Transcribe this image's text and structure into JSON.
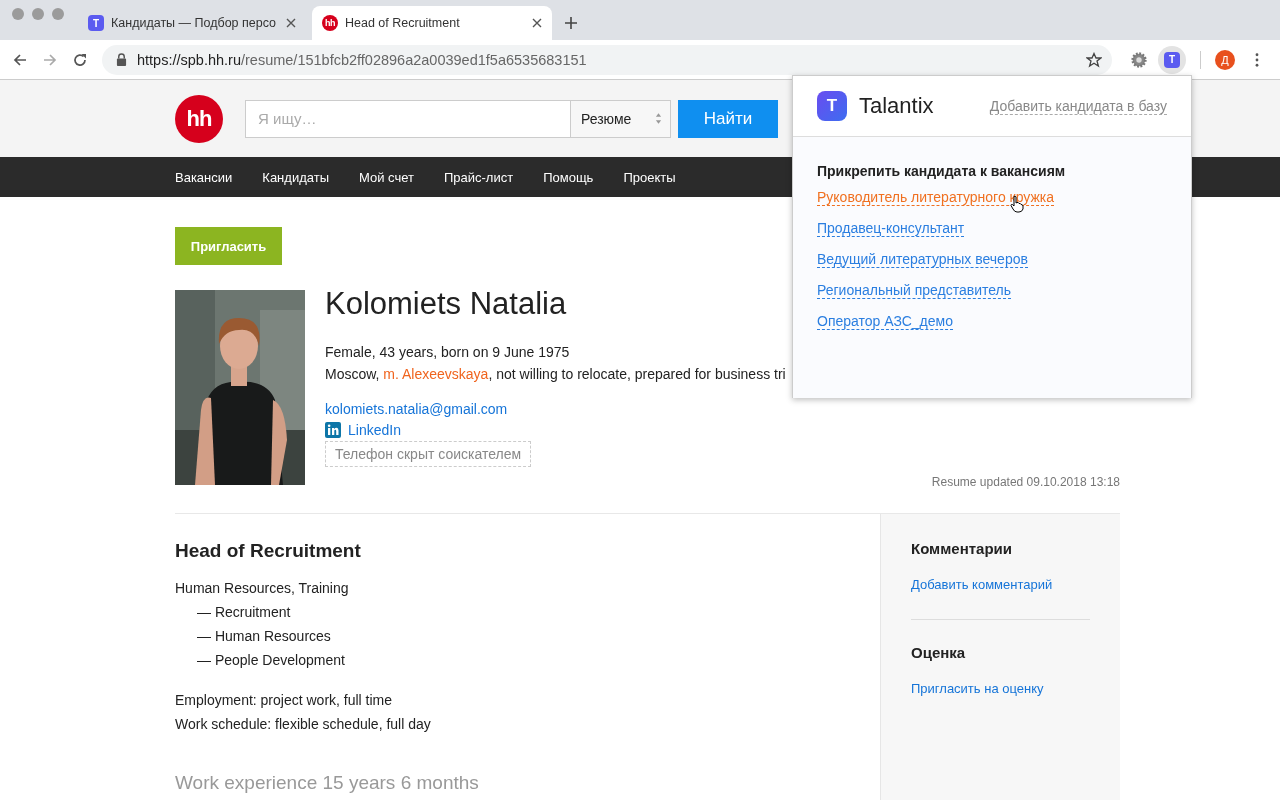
{
  "browser": {
    "tabs": [
      {
        "title": "Кандидаты — Подбор персо",
        "icon_label": "T",
        "kind": "talantix",
        "selected": false
      },
      {
        "title": "Head of Recruitment",
        "icon_label": "hh",
        "kind": "hh",
        "selected": true
      }
    ],
    "url": {
      "host": "https://spb.hh.ru",
      "path": "/resume/151bfcb2ff02896a2a0039ed1f5a6535683151"
    },
    "extension_label": "T",
    "avatar": "Д"
  },
  "header": {
    "logo": "hh",
    "search": {
      "placeholder": "Я ищу…"
    },
    "type_select": "Резюме",
    "search_button": "Найти"
  },
  "nav": [
    "Вакансии",
    "Кандидаты",
    "Мой счет",
    "Прайс-лист",
    "Помощь",
    "Проекты"
  ],
  "invite_button": "Пригласить",
  "profile": {
    "name": "Kolomiets Natalia",
    "details": "Female, 43 years, born on 9 June 1975",
    "city": "Moscow, ",
    "metro": "m. Alexeevskaya",
    "relocation": ", not willing to relocate, prepared for business tri",
    "email": "kolomiets.natalia@gmail.com",
    "linkedin": "LinkedIn",
    "phone": "Телефон скрыт соискателем",
    "updated": "Resume updated 09.10.2018 13:18"
  },
  "position": {
    "title": "Head of Recruitment",
    "field": "Human Resources, Training",
    "specializations": [
      "— Recruitment",
      "— Human Resources",
      "— People Development"
    ],
    "employment": "Employment: project work, full time",
    "schedule": "Work schedule: flexible schedule, full day",
    "experience": "Work experience 15 years 6 months"
  },
  "sidebar": [
    {
      "title": "Комментарии",
      "link": "Добавить комментарий"
    },
    {
      "title": "Оценка",
      "link": "Пригласить на оценку"
    }
  ],
  "popup": {
    "logo_label": "T",
    "brand": "Talantix",
    "add_link": "Добавить кандидата в базу",
    "heading": "Прикрепить кандидата к вакансиям",
    "vacancies": [
      {
        "title": "Руководитель литературного кружка",
        "highlighted": true
      },
      {
        "title": "Продавец-консультант",
        "highlighted": false
      },
      {
        "title": "Ведущий литературных вечеров",
        "highlighted": false
      },
      {
        "title": "Региональный представитель",
        "highlighted": false
      },
      {
        "title": "Оператор АЗС_демо",
        "highlighted": false
      }
    ]
  }
}
